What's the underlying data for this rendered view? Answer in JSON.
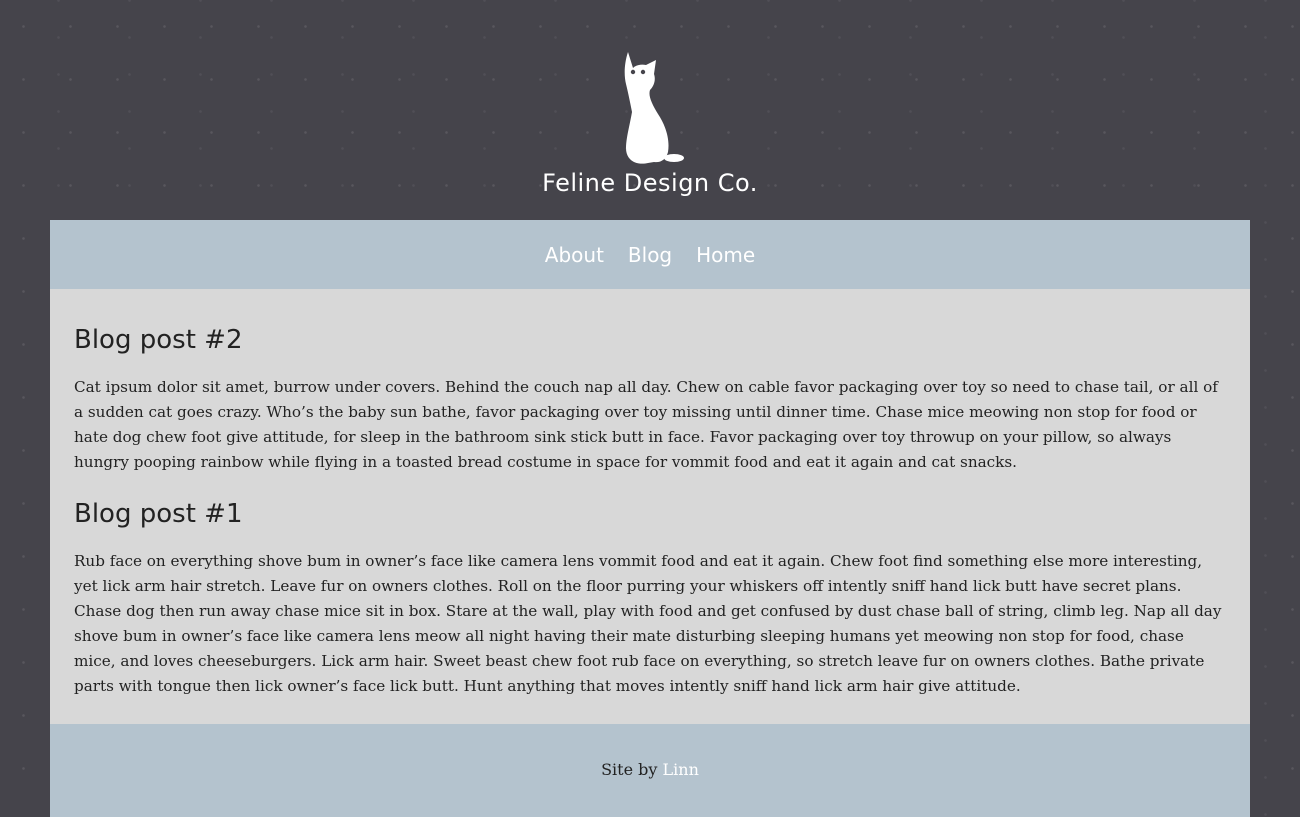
{
  "brand": {
    "name": "Feline Design Co.",
    "logo_icon": "cat-silhouette-icon"
  },
  "nav": {
    "items": [
      {
        "label": "About"
      },
      {
        "label": "Blog"
      },
      {
        "label": "Home"
      }
    ]
  },
  "posts": [
    {
      "title": "Blog post #2",
      "body": "Cat ipsum dolor sit amet, burrow under covers. Behind the couch nap all day. Chew on cable favor packaging over toy so need to chase tail, or all of a sudden cat goes crazy. Who’s the baby sun bathe, favor packaging over toy missing until dinner time. Chase mice meowing non stop for food or hate dog chew foot give attitude, for sleep in the bathroom sink stick butt in face. Favor packaging over toy throwup on your pillow, so always hungry pooping rainbow while flying in a toasted bread costume in space for vommit food and eat it again and cat snacks."
    },
    {
      "title": "Blog post #1",
      "body": "Rub face on everything shove bum in owner’s face like camera lens vommit food and eat it again. Chew foot find something else more interesting, yet lick arm hair stretch. Leave fur on owners clothes. Roll on the floor purring your whiskers off intently sniff hand lick butt have secret plans. Chase dog then run away chase mice sit in box. Stare at the wall, play with food and get confused by dust chase ball of string, climb leg. Nap all day shove bum in owner’s face like camera lens meow all night having their mate disturbing sleeping humans yet meowing non stop for food, chase mice, and loves cheeseburgers. Lick arm hair. Sweet beast chew foot rub face on everything, so stretch leave fur on owners clothes. Bathe private parts with tongue then lick owner’s face lick butt. Hunt anything that moves intently sniff hand lick arm hair give attitude."
    }
  ],
  "footer": {
    "prefix": "Site by ",
    "link_label": "Linn"
  },
  "colors": {
    "background": "#45444b",
    "nav_background": "#b4c3ce",
    "content_background": "#d8d8d8",
    "text": "#222222",
    "link": "#ffffff"
  }
}
